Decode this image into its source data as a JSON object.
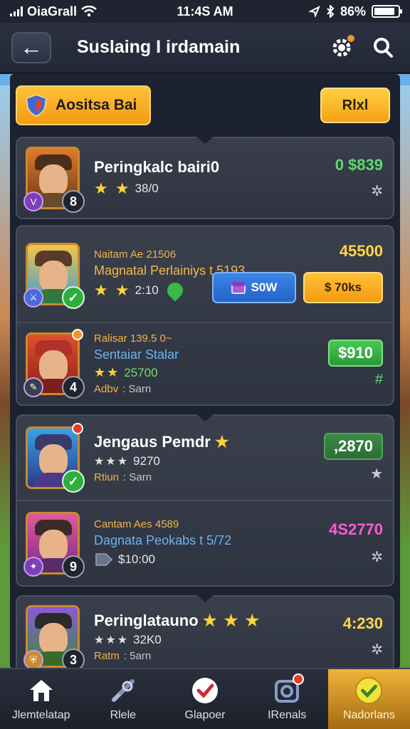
{
  "status_bar": {
    "carrier": "OiaGrall",
    "time": "11:4S AM",
    "battery": "86%"
  },
  "header": {
    "back_label": "←",
    "title": "Suslaing I irdamain"
  },
  "tabs": {
    "active_label": "Aositsa Bai",
    "next_label": "Rlxl"
  },
  "cards": [
    {
      "entries": [
        {
          "name": "Peringkalc bairi0",
          "stars": "★ ★",
          "score": "38/0",
          "badge": "8",
          "price": "0 $839",
          "side_icon": "✲"
        }
      ]
    },
    {
      "entries": [
        {
          "subtitle": "Naitam Ae 21506",
          "name": "Magnatal Perlainiys t 5193",
          "stars": "★ ★",
          "score": "2:10",
          "price": "45500",
          "btn_blue": "S0W",
          "btn_orange": "$ 70ks"
        },
        {
          "subtitle": "Ralisar 139.5 0~",
          "name": "Sentaiar Stalar",
          "stars": "★★",
          "score": "25700",
          "meta_label": "Adbv",
          "meta_value": ": Sarn",
          "badge": "4",
          "price": "$910",
          "side_icon": "#"
        }
      ]
    },
    {
      "entries": [
        {
          "name": "Jengaus Pemdr",
          "stars": "★",
          "stars_line": "★★★",
          "score": "9270",
          "meta_label": "Rtiun",
          "meta_value": ": Sarn",
          "price": ",2870",
          "side_icon": "★"
        },
        {
          "subtitle": "Cantam Aes 4589",
          "name": "Dagnata Peokabs t 5/72",
          "score": "$10:00",
          "badge": "9",
          "price": "4S2770",
          "side_icon": "✲"
        }
      ]
    },
    {
      "entries": [
        {
          "name": "Peringlatauno",
          "stars": "★ ★ ★",
          "stars_line": "★★★",
          "score": "32K0",
          "meta_label": "Ratm",
          "meta_value": ": 5arn",
          "badge": "3",
          "price": "4:230",
          "side_icon": "✲"
        }
      ]
    }
  ],
  "bottom_nav": [
    {
      "label": "Jlemtelatap",
      "icon": "home-icon"
    },
    {
      "label": "Rlele",
      "icon": "tools-icon"
    },
    {
      "label": "Glapoer",
      "icon": "check-badge-icon"
    },
    {
      "label": "IRenals",
      "icon": "camera-icon"
    },
    {
      "label": "Nadorlans",
      "icon": "check-circle-icon"
    }
  ],
  "colors": {
    "accent_orange": "#f39a12",
    "price_green": "#5ed96e",
    "price_gold": "#ffd74a",
    "price_pink": "#ff5ad1",
    "blue_button": "#2462c7"
  }
}
